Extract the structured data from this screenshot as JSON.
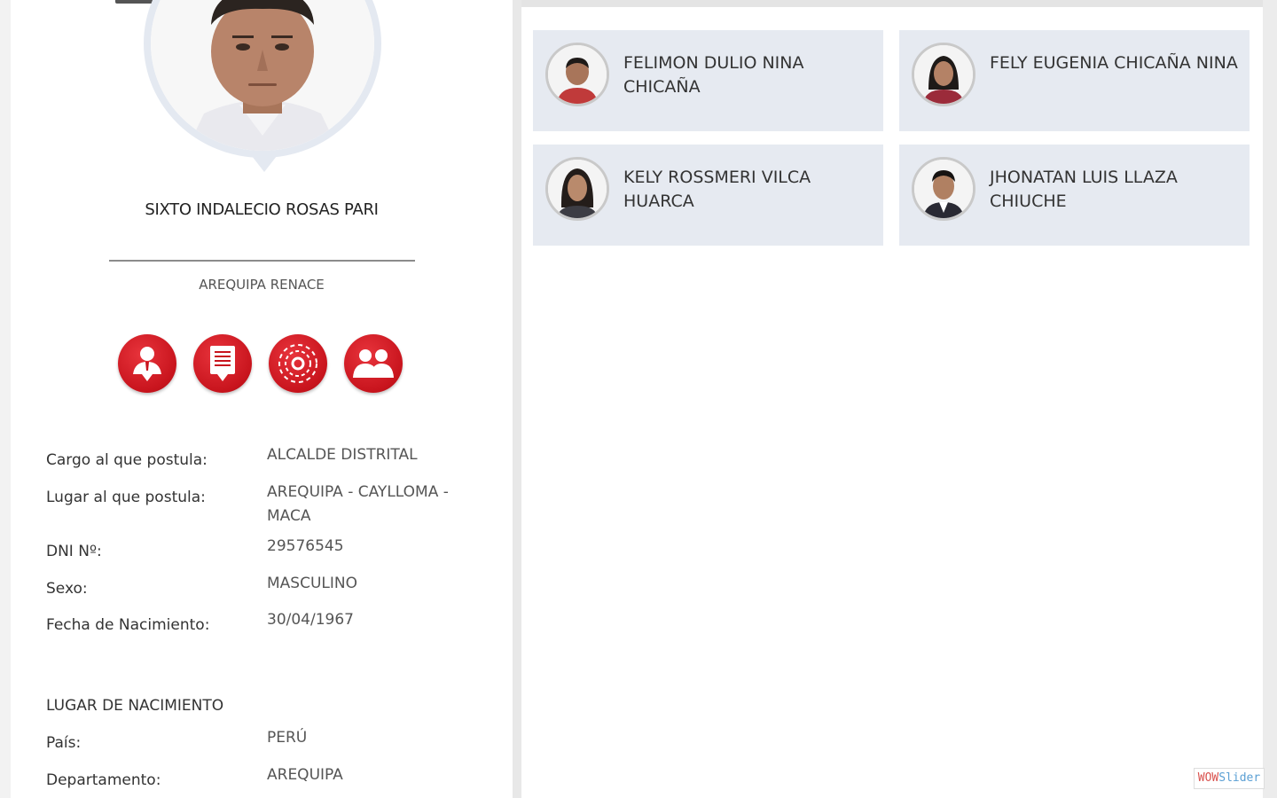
{
  "candidate": {
    "name": "SIXTO INDALECIO ROSAS PARI",
    "party": "AREQUIPA RENACE"
  },
  "actions": [
    {
      "icon": "resume-download-icon"
    },
    {
      "icon": "document-download-icon"
    },
    {
      "icon": "government-plan-icon"
    },
    {
      "icon": "team-icon"
    }
  ],
  "details": [
    {
      "label": "Cargo al que postula:",
      "value": "ALCALDE DISTRITAL"
    },
    {
      "label": "Lugar al que postula:",
      "value": "AREQUIPA - CAYLLOMA - MACA"
    },
    {
      "label": "DNI Nº:",
      "value": "29576545"
    },
    {
      "label": "Sexo:",
      "value": "MASCULINO"
    },
    {
      "label": "Fecha de Nacimiento:",
      "value": "30/04/1967"
    }
  ],
  "birthplace": {
    "title": "LUGAR DE NACIMIENTO",
    "rows": [
      {
        "label": "País:",
        "value": "PERÚ"
      },
      {
        "label": "Departamento:",
        "value": "AREQUIPA"
      }
    ]
  },
  "team": [
    {
      "name": "FELIMON DULIO NINA CHICAÑA",
      "gender": "male"
    },
    {
      "name": "FELY EUGENIA CHICAÑA NINA",
      "gender": "female"
    },
    {
      "name": "KELY ROSSMERI VILCA HUARCA",
      "gender": "female"
    },
    {
      "name": "JHONATAN LUIS LLAZA CHIUCHE",
      "gender": "male"
    }
  ],
  "badge": {
    "part1": "WOW",
    "part2": "Slider"
  },
  "colors": {
    "accent": "#c8141d",
    "card_bg": "#e6eaf1"
  }
}
